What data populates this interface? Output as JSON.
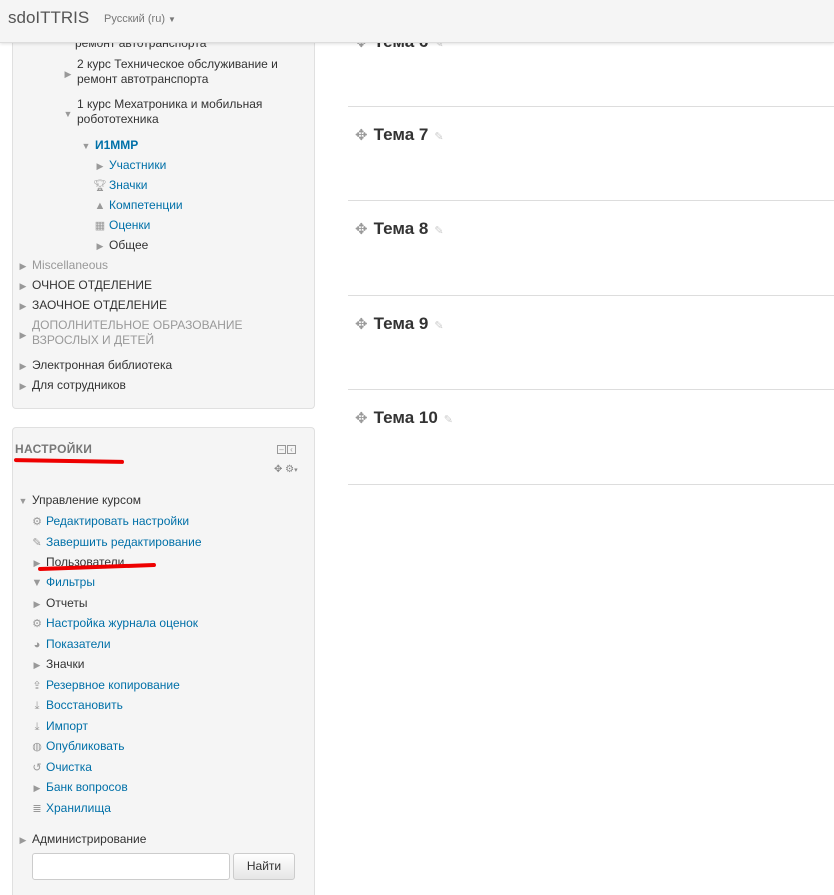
{
  "navbar": {
    "brand": "sdoITTRIS",
    "language": "Русский (ru)"
  },
  "nav_tree": {
    "partial_item": "ремонт автотранспорта",
    "course2_line1": "2 курс Техническое обслуживание и",
    "course2_line2": "ремонт автотранспорта",
    "course1_line1": "1 курс Мехатроника и мобильная",
    "course1_line2": "робототехника",
    "current_course": "И1ММР",
    "participants": "Участники",
    "badges": "Значки",
    "competencies": "Компетенции",
    "grades": "Оценки",
    "general": "Общее",
    "misc": "Miscellaneous",
    "fulltime": "ОЧНОЕ ОТДЕЛЕНИЕ",
    "extramural": "ЗАОЧНОЕ ОТДЕЛЕНИЕ",
    "addl_line1": "ДОПОЛНИТЕЛЬНОЕ ОБРАЗОВАНИЕ",
    "addl_line2": "ВЗРОСЛЫХ И ДЕТЕЙ",
    "library": "Электронная библиотека",
    "staff": "Для сотрудников"
  },
  "settings": {
    "title": "НАСТРОЙКИ",
    "course_admin": "Управление курсом",
    "items": [
      "Редактировать настройки",
      "Завершить редактирование",
      "Пользователи",
      "Фильтры",
      "Отчеты",
      "Настройка журнала оценок",
      "Показатели",
      "Значки",
      "Резервное копирование",
      "Восстановить",
      "Импорт",
      "Опубликовать",
      "Очистка",
      "Банк вопросов",
      "Хранилища"
    ],
    "site_admin": "Администрирование",
    "search_button": "Найти",
    "search_value": ""
  },
  "topics": [
    "Тема 6",
    "Тема 7",
    "Тема 8",
    "Тема 9",
    "Тема 10"
  ],
  "colors": {
    "link": "#0070a8",
    "annotation": "#e00000"
  }
}
